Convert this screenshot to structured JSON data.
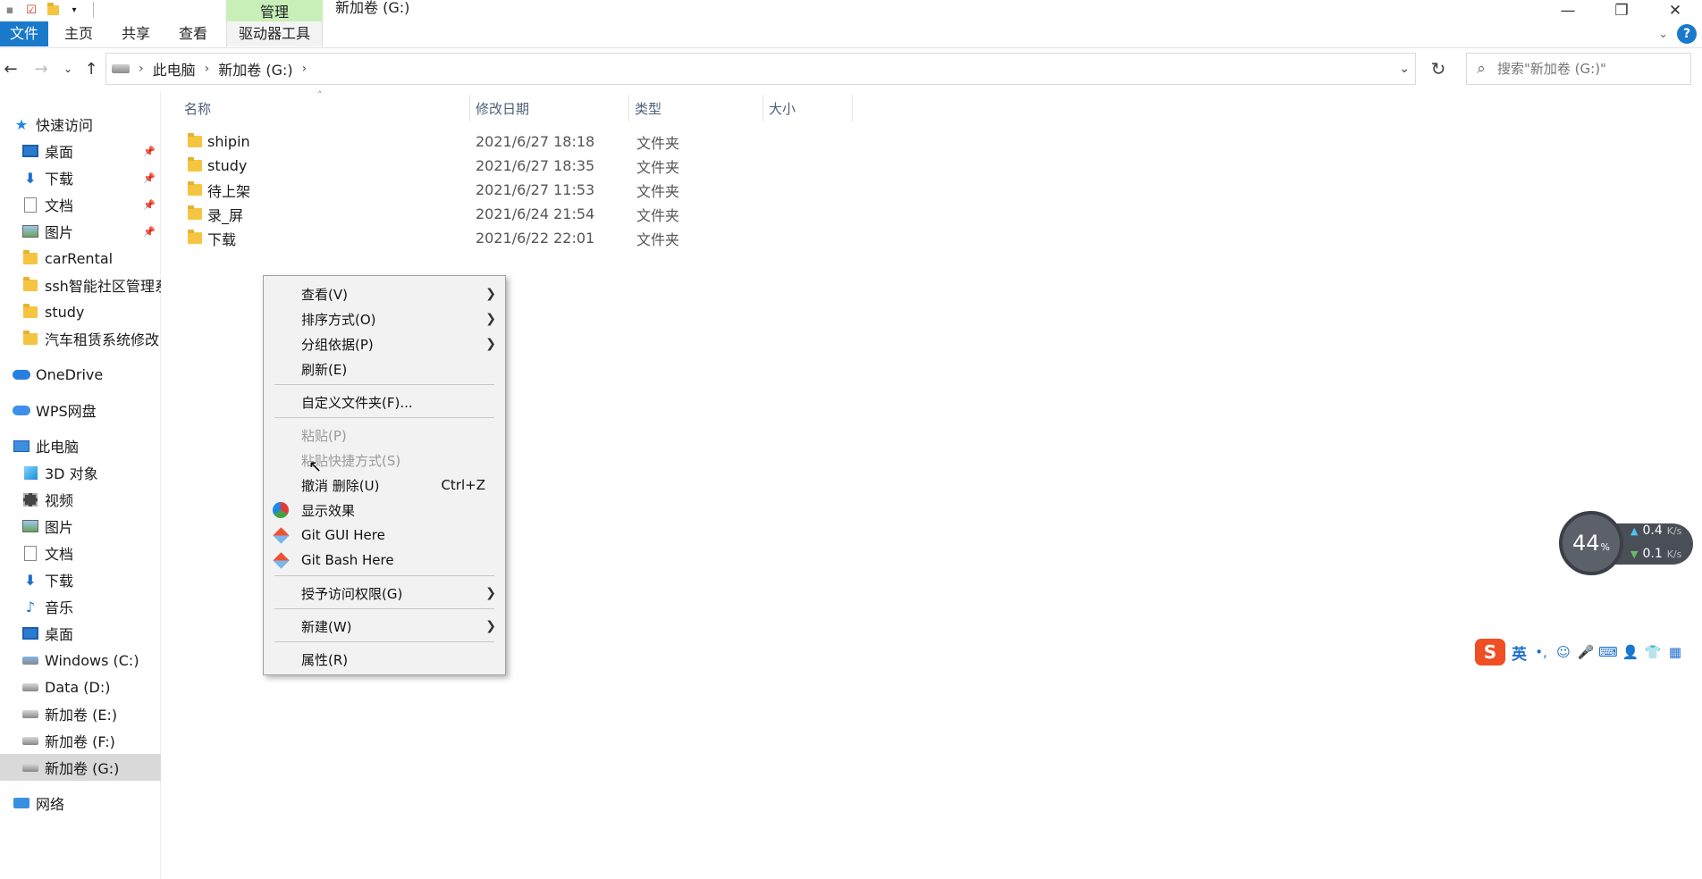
{
  "window": {
    "title": "新加卷 (G:)",
    "context_tab": "管理",
    "controls": {
      "minimize": "—",
      "restore": "❐",
      "close": "✕"
    }
  },
  "ribbon": {
    "tabs": [
      "文件",
      "主页",
      "共享",
      "查看",
      "驱动器工具"
    ],
    "help": "?"
  },
  "address": {
    "crumbs": [
      "此电脑",
      "新加卷 (G:)"
    ],
    "search_placeholder": "搜索\"新加卷 (G:)\""
  },
  "sidebar": {
    "quick_access": "快速访问",
    "quick_items": [
      "桌面",
      "下载",
      "文档",
      "图片",
      "carRental",
      "ssh智能社区管理系",
      "study",
      "汽车租赁系统修改"
    ],
    "onedrive": "OneDrive",
    "wps": "WPS网盘",
    "this_pc": "此电脑",
    "pc_items": [
      "3D 对象",
      "视频",
      "图片",
      "文档",
      "下载",
      "音乐",
      "桌面",
      "Windows (C:)",
      "Data (D:)",
      "新加卷 (E:)",
      "新加卷 (F:)",
      "新加卷 (G:)"
    ],
    "network": "网络"
  },
  "columns": {
    "name": "名称",
    "date": "修改日期",
    "type": "类型",
    "size": "大小"
  },
  "files": [
    {
      "name": "shipin",
      "date": "2021/6/27 18:18",
      "type": "文件夹"
    },
    {
      "name": "study",
      "date": "2021/6/27 18:35",
      "type": "文件夹"
    },
    {
      "name": "待上架",
      "date": "2021/6/27 11:53",
      "type": "文件夹"
    },
    {
      "name": "录_屏",
      "date": "2021/6/24 21:54",
      "type": "文件夹"
    },
    {
      "name": "下载",
      "date": "2021/6/22 22:01",
      "type": "文件夹"
    }
  ],
  "context_menu": {
    "view": "查看(V)",
    "sort": "排序方式(O)",
    "group": "分组依据(P)",
    "refresh": "刷新(E)",
    "customize": "自定义文件夹(F)...",
    "paste": "粘贴(P)",
    "paste_shortcut": "粘贴快捷方式(S)",
    "undo": "撤消 删除(U)",
    "undo_shortcut": "Ctrl+Z",
    "display_effects": "显示效果",
    "git_gui": "Git GUI Here",
    "git_bash": "Git Bash Here",
    "grant_access": "授予访问权限(G)",
    "new": "新建(W)",
    "properties": "属性(R)"
  },
  "net_widget": {
    "percent": "44",
    "percent_sign": "%",
    "up": "0.4",
    "down": "0.1",
    "unit": "K/s"
  },
  "ime": {
    "lang": "英",
    "punct": "•,"
  }
}
